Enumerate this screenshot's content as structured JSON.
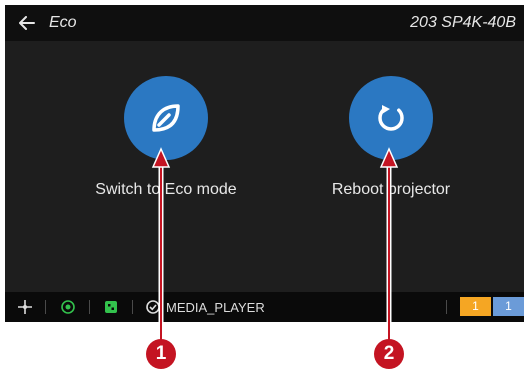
{
  "header": {
    "back_icon": "back-arrow-icon",
    "title": "Eco",
    "device": "203 SP4K-40B"
  },
  "actions": [
    {
      "label": "Switch to Eco mode",
      "icon": "leaf-icon",
      "color": "#2b78c2"
    },
    {
      "label": "Reboot projector",
      "icon": "reboot-icon",
      "color": "#2b78c2"
    }
  ],
  "statusbar": {
    "icons": [
      "move-icon",
      "network-icon",
      "input-grid-icon",
      "check-circle-icon"
    ],
    "media": "MEDIA_PLAYER",
    "slots": [
      {
        "label": "1",
        "color": "#f5a623"
      },
      {
        "label": "1",
        "color": "#6b9bd8"
      }
    ]
  },
  "callouts": [
    {
      "label": "1",
      "color": "#c41422"
    },
    {
      "label": "2",
      "color": "#c41422"
    }
  ]
}
